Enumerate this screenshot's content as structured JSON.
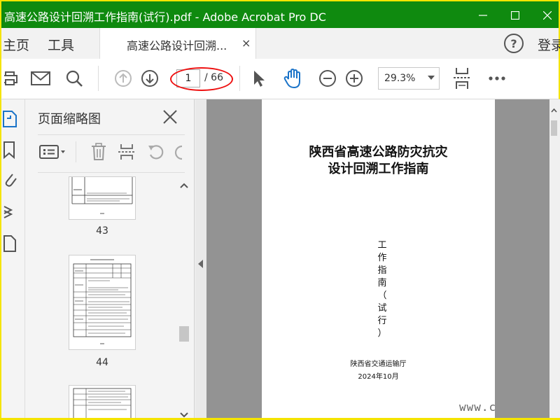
{
  "window": {
    "title": "高速公路设计回溯工作指南(试行).pdf - Adobe Acrobat Pro DC"
  },
  "menu": {
    "home": "主页",
    "tools": "工具",
    "tab_label": "高速公路设计回溯...",
    "tab_close": "×",
    "help": "?",
    "login": "登录"
  },
  "toolbar": {
    "current_page": "1",
    "total_pages": "/ 66",
    "zoom": "29.3%"
  },
  "panel": {
    "title": "页面缩略图",
    "thumbnails": [
      {
        "page": "43"
      },
      {
        "page": "44"
      }
    ]
  },
  "document": {
    "title_line1": "陕西省高速公路防灾抗灾",
    "title_line2": "设计回溯工作指南",
    "vertical_chars": [
      "工",
      "作",
      "指",
      "南",
      "（",
      "试",
      "行",
      "）"
    ],
    "org": "陕西省交通运输厅",
    "date": "2024年10月"
  },
  "watermark": "www.c",
  "colors": {
    "titlebar": "#0f8a0f",
    "highlight": "#e11111",
    "hand_tool": "#1a73c8",
    "frame": "#f5e400"
  }
}
